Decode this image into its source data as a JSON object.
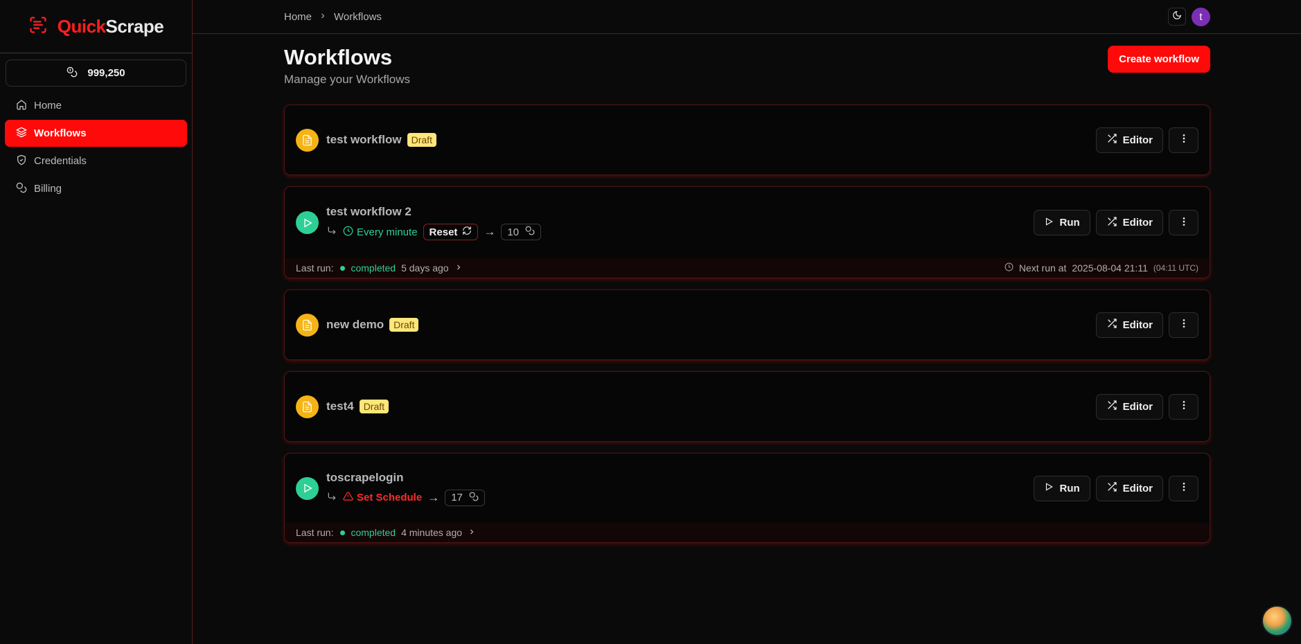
{
  "brand": {
    "quick": "Quick",
    "scrape": "Scrape"
  },
  "credits": {
    "value": "999,250"
  },
  "sidebar": {
    "items": [
      {
        "label": "Home",
        "icon": "home-icon",
        "active": false
      },
      {
        "label": "Workflows",
        "icon": "layers-icon",
        "active": true
      },
      {
        "label": "Credentials",
        "icon": "shield-icon",
        "active": false
      },
      {
        "label": "Billing",
        "icon": "coins-icon",
        "active": false
      }
    ]
  },
  "breadcrumb": {
    "home": "Home",
    "current": "Workflows"
  },
  "header": {
    "avatar_letter": "t",
    "title": "Workflows",
    "subtitle": "Manage your Workflows",
    "create_label": "Create workflow"
  },
  "labels": {
    "draft": "Draft",
    "run": "Run",
    "editor": "Editor",
    "reset": "Reset",
    "last_run": "Last run:",
    "next_run_at": "Next run at"
  },
  "workflows": [
    {
      "name": "test workflow",
      "status": "Draft"
    },
    {
      "name": "test workflow 2",
      "status": "Published",
      "schedule": "Every minute",
      "credits": "10",
      "last_run_status": "completed",
      "last_run_time": "5 days ago",
      "next_run": "2025-08-04 21:11",
      "next_run_utc": "(04:11 UTC)"
    },
    {
      "name": "new demo",
      "status": "Draft"
    },
    {
      "name": "test4",
      "status": "Draft"
    },
    {
      "name": "toscrapelogin",
      "status": "Published",
      "schedule": "Set Schedule",
      "credits": "17",
      "last_run_status": "completed",
      "last_run_time": "4 minutes ago"
    }
  ],
  "colors": {
    "accent": "#ff0a0a",
    "draft": "#f5b416",
    "published": "#2ecf95",
    "avatar": "#7b2fb5"
  }
}
